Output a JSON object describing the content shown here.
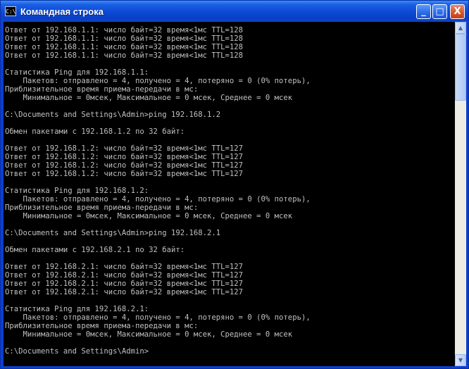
{
  "window": {
    "title": "Командная строка",
    "icon_text": "C:\\",
    "controls": {
      "minimize_glyph": "_",
      "maximize_glyph": "□",
      "close_glyph": "X"
    }
  },
  "console": {
    "lines": [
      "Ответ от 192.168.1.1: число байт=32 время<1мс TTL=128",
      "Ответ от 192.168.1.1: число байт=32 время<1мс TTL=128",
      "Ответ от 192.168.1.1: число байт=32 время<1мс TTL=128",
      "Ответ от 192.168.1.1: число байт=32 время<1мс TTL=128",
      "",
      "Статистика Ping для 192.168.1.1:",
      "    Пакетов: отправлено = 4, получено = 4, потеряно = 0 (0% потерь),",
      "Приблизительное время приема-передачи в мс:",
      "    Минимальное = 0мсек, Максимальное = 0 мсек, Среднее = 0 мсек",
      "",
      "C:\\Documents and Settings\\Admin>ping 192.168.1.2",
      "",
      "Обмен пакетами с 192.168.1.2 по 32 байт:",
      "",
      "Ответ от 192.168.1.2: число байт=32 время<1мс TTL=127",
      "Ответ от 192.168.1.2: число байт=32 время<1мс TTL=127",
      "Ответ от 192.168.1.2: число байт=32 время<1мс TTL=127",
      "Ответ от 192.168.1.2: число байт=32 время<1мс TTL=127",
      "",
      "Статистика Ping для 192.168.1.2:",
      "    Пакетов: отправлено = 4, получено = 4, потеряно = 0 (0% потерь),",
      "Приблизительное время приема-передачи в мс:",
      "    Минимальное = 0мсек, Максимальное = 0 мсек, Среднее = 0 мсек",
      "",
      "C:\\Documents and Settings\\Admin>ping 192.168.2.1",
      "",
      "Обмен пакетами с 192.168.2.1 по 32 байт:",
      "",
      "Ответ от 192.168.2.1: число байт=32 время<1мс TTL=127",
      "Ответ от 192.168.2.1: число байт=32 время<1мс TTL=127",
      "Ответ от 192.168.2.1: число байт=32 время<1мс TTL=127",
      "Ответ от 192.168.2.1: число байт=32 время<1мс TTL=127",
      "",
      "Статистика Ping для 192.168.2.1:",
      "    Пакетов: отправлено = 4, получено = 4, потеряно = 0 (0% потерь),",
      "Приблизительное время приема-передачи в мс:",
      "    Минимальное = 0мсек, Максимальное = 0 мсек, Среднее = 0 мсек",
      "",
      "C:\\Documents and Settings\\Admin>"
    ]
  },
  "scrollbar": {
    "up_glyph": "▲",
    "down_glyph": "▼",
    "thumb_position": 0.0
  },
  "colors": {
    "console_bg": "#000000",
    "console_text": "#c0c0c0",
    "titlebar": "#0a49d6"
  }
}
